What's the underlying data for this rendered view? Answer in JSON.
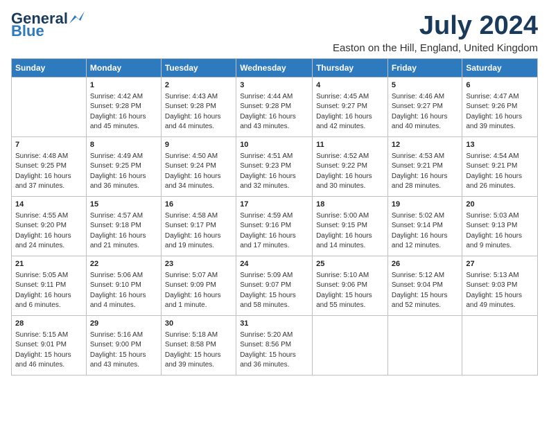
{
  "header": {
    "logo_general": "General",
    "logo_blue": "Blue",
    "month_year": "July 2024",
    "location": "Easton on the Hill, England, United Kingdom"
  },
  "days_of_week": [
    "Sunday",
    "Monday",
    "Tuesday",
    "Wednesday",
    "Thursday",
    "Friday",
    "Saturday"
  ],
  "weeks": [
    [
      {
        "day": "",
        "info": ""
      },
      {
        "day": "1",
        "info": "Sunrise: 4:42 AM\nSunset: 9:28 PM\nDaylight: 16 hours\nand 45 minutes."
      },
      {
        "day": "2",
        "info": "Sunrise: 4:43 AM\nSunset: 9:28 PM\nDaylight: 16 hours\nand 44 minutes."
      },
      {
        "day": "3",
        "info": "Sunrise: 4:44 AM\nSunset: 9:28 PM\nDaylight: 16 hours\nand 43 minutes."
      },
      {
        "day": "4",
        "info": "Sunrise: 4:45 AM\nSunset: 9:27 PM\nDaylight: 16 hours\nand 42 minutes."
      },
      {
        "day": "5",
        "info": "Sunrise: 4:46 AM\nSunset: 9:27 PM\nDaylight: 16 hours\nand 40 minutes."
      },
      {
        "day": "6",
        "info": "Sunrise: 4:47 AM\nSunset: 9:26 PM\nDaylight: 16 hours\nand 39 minutes."
      }
    ],
    [
      {
        "day": "7",
        "info": "Sunrise: 4:48 AM\nSunset: 9:25 PM\nDaylight: 16 hours\nand 37 minutes."
      },
      {
        "day": "8",
        "info": "Sunrise: 4:49 AM\nSunset: 9:25 PM\nDaylight: 16 hours\nand 36 minutes."
      },
      {
        "day": "9",
        "info": "Sunrise: 4:50 AM\nSunset: 9:24 PM\nDaylight: 16 hours\nand 34 minutes."
      },
      {
        "day": "10",
        "info": "Sunrise: 4:51 AM\nSunset: 9:23 PM\nDaylight: 16 hours\nand 32 minutes."
      },
      {
        "day": "11",
        "info": "Sunrise: 4:52 AM\nSunset: 9:22 PM\nDaylight: 16 hours\nand 30 minutes."
      },
      {
        "day": "12",
        "info": "Sunrise: 4:53 AM\nSunset: 9:21 PM\nDaylight: 16 hours\nand 28 minutes."
      },
      {
        "day": "13",
        "info": "Sunrise: 4:54 AM\nSunset: 9:21 PM\nDaylight: 16 hours\nand 26 minutes."
      }
    ],
    [
      {
        "day": "14",
        "info": "Sunrise: 4:55 AM\nSunset: 9:20 PM\nDaylight: 16 hours\nand 24 minutes."
      },
      {
        "day": "15",
        "info": "Sunrise: 4:57 AM\nSunset: 9:18 PM\nDaylight: 16 hours\nand 21 minutes."
      },
      {
        "day": "16",
        "info": "Sunrise: 4:58 AM\nSunset: 9:17 PM\nDaylight: 16 hours\nand 19 minutes."
      },
      {
        "day": "17",
        "info": "Sunrise: 4:59 AM\nSunset: 9:16 PM\nDaylight: 16 hours\nand 17 minutes."
      },
      {
        "day": "18",
        "info": "Sunrise: 5:00 AM\nSunset: 9:15 PM\nDaylight: 16 hours\nand 14 minutes."
      },
      {
        "day": "19",
        "info": "Sunrise: 5:02 AM\nSunset: 9:14 PM\nDaylight: 16 hours\nand 12 minutes."
      },
      {
        "day": "20",
        "info": "Sunrise: 5:03 AM\nSunset: 9:13 PM\nDaylight: 16 hours\nand 9 minutes."
      }
    ],
    [
      {
        "day": "21",
        "info": "Sunrise: 5:05 AM\nSunset: 9:11 PM\nDaylight: 16 hours\nand 6 minutes."
      },
      {
        "day": "22",
        "info": "Sunrise: 5:06 AM\nSunset: 9:10 PM\nDaylight: 16 hours\nand 4 minutes."
      },
      {
        "day": "23",
        "info": "Sunrise: 5:07 AM\nSunset: 9:09 PM\nDaylight: 16 hours\nand 1 minute."
      },
      {
        "day": "24",
        "info": "Sunrise: 5:09 AM\nSunset: 9:07 PM\nDaylight: 15 hours\nand 58 minutes."
      },
      {
        "day": "25",
        "info": "Sunrise: 5:10 AM\nSunset: 9:06 PM\nDaylight: 15 hours\nand 55 minutes."
      },
      {
        "day": "26",
        "info": "Sunrise: 5:12 AM\nSunset: 9:04 PM\nDaylight: 15 hours\nand 52 minutes."
      },
      {
        "day": "27",
        "info": "Sunrise: 5:13 AM\nSunset: 9:03 PM\nDaylight: 15 hours\nand 49 minutes."
      }
    ],
    [
      {
        "day": "28",
        "info": "Sunrise: 5:15 AM\nSunset: 9:01 PM\nDaylight: 15 hours\nand 46 minutes."
      },
      {
        "day": "29",
        "info": "Sunrise: 5:16 AM\nSunset: 9:00 PM\nDaylight: 15 hours\nand 43 minutes."
      },
      {
        "day": "30",
        "info": "Sunrise: 5:18 AM\nSunset: 8:58 PM\nDaylight: 15 hours\nand 39 minutes."
      },
      {
        "day": "31",
        "info": "Sunrise: 5:20 AM\nSunset: 8:56 PM\nDaylight: 15 hours\nand 36 minutes."
      },
      {
        "day": "",
        "info": ""
      },
      {
        "day": "",
        "info": ""
      },
      {
        "day": "",
        "info": ""
      }
    ]
  ]
}
